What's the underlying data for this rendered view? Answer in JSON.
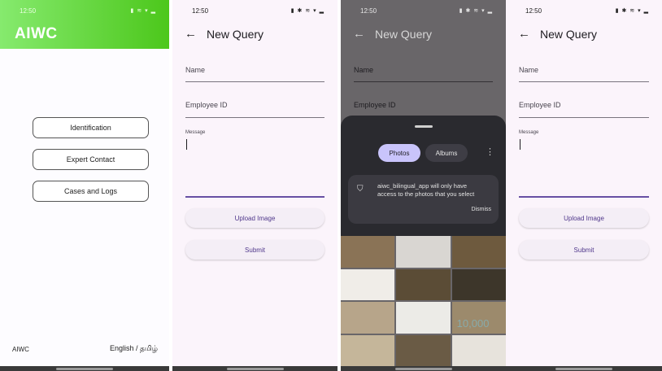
{
  "home": {
    "status": {
      "time": "12:50",
      "icons": "▮ ≋ ▾ ▂"
    },
    "app_title": "AIWC",
    "menu": [
      {
        "label": "Identification"
      },
      {
        "label": "Expert Contact"
      },
      {
        "label": "Cases and Logs"
      }
    ],
    "footer": {
      "brand": "AIWC",
      "language": "English / தமிழ்"
    }
  },
  "form": {
    "status": {
      "time": "12:50",
      "icons": "▮ ✱ ≋ ▾ ▂"
    },
    "title": "New Query",
    "fields": {
      "name": "Name",
      "employee_id": "Employee ID",
      "message": "Message"
    },
    "upload_button": "Upload Image",
    "submit_button": "Submit"
  },
  "picker": {
    "tabs": {
      "photos": "Photos",
      "albums": "Albums"
    },
    "notice": "aiwc_bilingual_app will only have access to the photos that you select",
    "dismiss": "Dismiss",
    "counter": "10,000",
    "thumb_colors": [
      "#8a7356",
      "#d9d6d2",
      "#6e5a3e",
      "#f0ede8",
      "#5b4c36",
      "#3d362a",
      "#b7a58a",
      "#ecebe7",
      "#9c8a6c",
      "#c5b69a",
      "#6a5b45",
      "#e7e3dc"
    ]
  },
  "colors": {
    "brand_green_start": "#86ea6e",
    "brand_green_end": "#4cc71b",
    "accent": "#6750a4",
    "form_bg": "#fbf4fb"
  }
}
